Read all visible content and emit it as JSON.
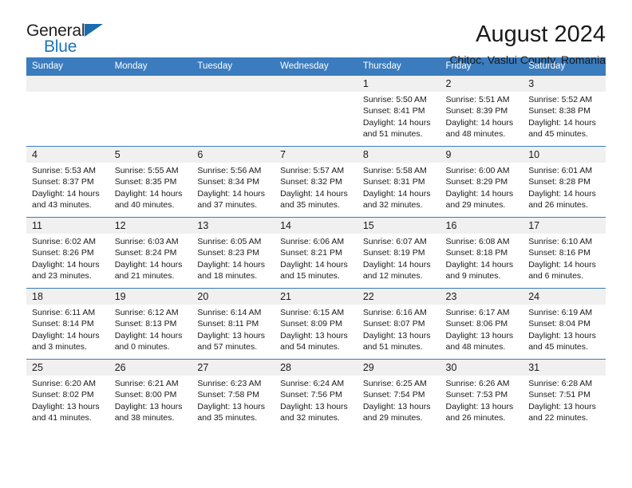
{
  "brand": {
    "name_top": "General",
    "name_bottom": "Blue",
    "triangle_color": "#1b6cb0"
  },
  "header": {
    "title": "August 2024",
    "subtitle": "Chitoc, Vaslui County, Romania"
  },
  "theme": {
    "header_blue": "#3a7cbe",
    "daynum_bg": "#f0f0f0",
    "text": "#1a1a1a"
  },
  "calendar": {
    "weekday_headers": [
      "Sunday",
      "Monday",
      "Tuesday",
      "Wednesday",
      "Thursday",
      "Friday",
      "Saturday"
    ],
    "weeks": [
      [
        {
          "day": "",
          "blank": true
        },
        {
          "day": "",
          "blank": true
        },
        {
          "day": "",
          "blank": true
        },
        {
          "day": "",
          "blank": true
        },
        {
          "day": "1",
          "sunrise": "Sunrise: 5:50 AM",
          "sunset": "Sunset: 8:41 PM",
          "daylight": "Daylight: 14 hours and 51 minutes."
        },
        {
          "day": "2",
          "sunrise": "Sunrise: 5:51 AM",
          "sunset": "Sunset: 8:39 PM",
          "daylight": "Daylight: 14 hours and 48 minutes."
        },
        {
          "day": "3",
          "sunrise": "Sunrise: 5:52 AM",
          "sunset": "Sunset: 8:38 PM",
          "daylight": "Daylight: 14 hours and 45 minutes."
        }
      ],
      [
        {
          "day": "4",
          "sunrise": "Sunrise: 5:53 AM",
          "sunset": "Sunset: 8:37 PM",
          "daylight": "Daylight: 14 hours and 43 minutes."
        },
        {
          "day": "5",
          "sunrise": "Sunrise: 5:55 AM",
          "sunset": "Sunset: 8:35 PM",
          "daylight": "Daylight: 14 hours and 40 minutes."
        },
        {
          "day": "6",
          "sunrise": "Sunrise: 5:56 AM",
          "sunset": "Sunset: 8:34 PM",
          "daylight": "Daylight: 14 hours and 37 minutes."
        },
        {
          "day": "7",
          "sunrise": "Sunrise: 5:57 AM",
          "sunset": "Sunset: 8:32 PM",
          "daylight": "Daylight: 14 hours and 35 minutes."
        },
        {
          "day": "8",
          "sunrise": "Sunrise: 5:58 AM",
          "sunset": "Sunset: 8:31 PM",
          "daylight": "Daylight: 14 hours and 32 minutes."
        },
        {
          "day": "9",
          "sunrise": "Sunrise: 6:00 AM",
          "sunset": "Sunset: 8:29 PM",
          "daylight": "Daylight: 14 hours and 29 minutes."
        },
        {
          "day": "10",
          "sunrise": "Sunrise: 6:01 AM",
          "sunset": "Sunset: 8:28 PM",
          "daylight": "Daylight: 14 hours and 26 minutes."
        }
      ],
      [
        {
          "day": "11",
          "sunrise": "Sunrise: 6:02 AM",
          "sunset": "Sunset: 8:26 PM",
          "daylight": "Daylight: 14 hours and 23 minutes."
        },
        {
          "day": "12",
          "sunrise": "Sunrise: 6:03 AM",
          "sunset": "Sunset: 8:24 PM",
          "daylight": "Daylight: 14 hours and 21 minutes."
        },
        {
          "day": "13",
          "sunrise": "Sunrise: 6:05 AM",
          "sunset": "Sunset: 8:23 PM",
          "daylight": "Daylight: 14 hours and 18 minutes."
        },
        {
          "day": "14",
          "sunrise": "Sunrise: 6:06 AM",
          "sunset": "Sunset: 8:21 PM",
          "daylight": "Daylight: 14 hours and 15 minutes."
        },
        {
          "day": "15",
          "sunrise": "Sunrise: 6:07 AM",
          "sunset": "Sunset: 8:19 PM",
          "daylight": "Daylight: 14 hours and 12 minutes."
        },
        {
          "day": "16",
          "sunrise": "Sunrise: 6:08 AM",
          "sunset": "Sunset: 8:18 PM",
          "daylight": "Daylight: 14 hours and 9 minutes."
        },
        {
          "day": "17",
          "sunrise": "Sunrise: 6:10 AM",
          "sunset": "Sunset: 8:16 PM",
          "daylight": "Daylight: 14 hours and 6 minutes."
        }
      ],
      [
        {
          "day": "18",
          "sunrise": "Sunrise: 6:11 AM",
          "sunset": "Sunset: 8:14 PM",
          "daylight": "Daylight: 14 hours and 3 minutes."
        },
        {
          "day": "19",
          "sunrise": "Sunrise: 6:12 AM",
          "sunset": "Sunset: 8:13 PM",
          "daylight": "Daylight: 14 hours and 0 minutes."
        },
        {
          "day": "20",
          "sunrise": "Sunrise: 6:14 AM",
          "sunset": "Sunset: 8:11 PM",
          "daylight": "Daylight: 13 hours and 57 minutes."
        },
        {
          "day": "21",
          "sunrise": "Sunrise: 6:15 AM",
          "sunset": "Sunset: 8:09 PM",
          "daylight": "Daylight: 13 hours and 54 minutes."
        },
        {
          "day": "22",
          "sunrise": "Sunrise: 6:16 AM",
          "sunset": "Sunset: 8:07 PM",
          "daylight": "Daylight: 13 hours and 51 minutes."
        },
        {
          "day": "23",
          "sunrise": "Sunrise: 6:17 AM",
          "sunset": "Sunset: 8:06 PM",
          "daylight": "Daylight: 13 hours and 48 minutes."
        },
        {
          "day": "24",
          "sunrise": "Sunrise: 6:19 AM",
          "sunset": "Sunset: 8:04 PM",
          "daylight": "Daylight: 13 hours and 45 minutes."
        }
      ],
      [
        {
          "day": "25",
          "sunrise": "Sunrise: 6:20 AM",
          "sunset": "Sunset: 8:02 PM",
          "daylight": "Daylight: 13 hours and 41 minutes."
        },
        {
          "day": "26",
          "sunrise": "Sunrise: 6:21 AM",
          "sunset": "Sunset: 8:00 PM",
          "daylight": "Daylight: 13 hours and 38 minutes."
        },
        {
          "day": "27",
          "sunrise": "Sunrise: 6:23 AM",
          "sunset": "Sunset: 7:58 PM",
          "daylight": "Daylight: 13 hours and 35 minutes."
        },
        {
          "day": "28",
          "sunrise": "Sunrise: 6:24 AM",
          "sunset": "Sunset: 7:56 PM",
          "daylight": "Daylight: 13 hours and 32 minutes."
        },
        {
          "day": "29",
          "sunrise": "Sunrise: 6:25 AM",
          "sunset": "Sunset: 7:54 PM",
          "daylight": "Daylight: 13 hours and 29 minutes."
        },
        {
          "day": "30",
          "sunrise": "Sunrise: 6:26 AM",
          "sunset": "Sunset: 7:53 PM",
          "daylight": "Daylight: 13 hours and 26 minutes."
        },
        {
          "day": "31",
          "sunrise": "Sunrise: 6:28 AM",
          "sunset": "Sunset: 7:51 PM",
          "daylight": "Daylight: 13 hours and 22 minutes."
        }
      ]
    ]
  }
}
